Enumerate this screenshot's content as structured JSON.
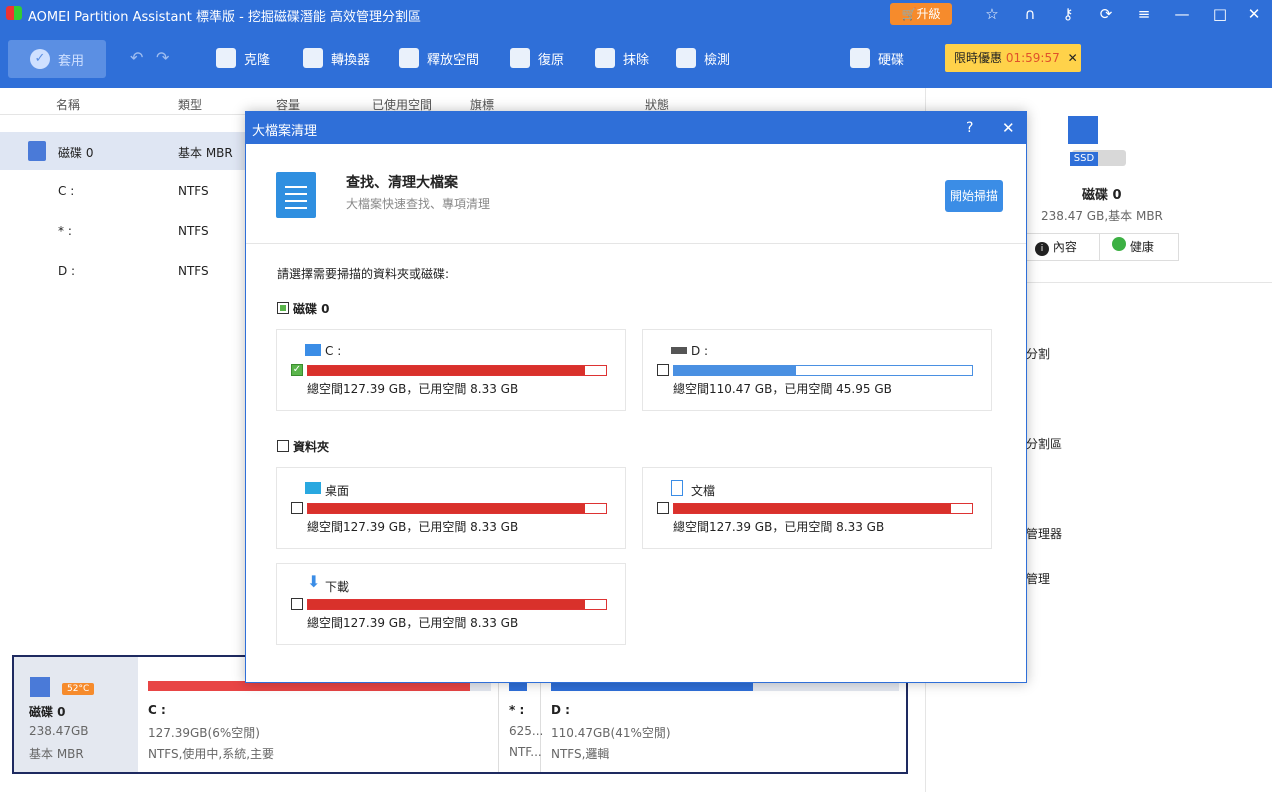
{
  "app": {
    "title": "AOMEI Partition Assistant 標準版 - 挖掘磁碟潛能 高效管理分割區",
    "upgrade": "升級"
  },
  "toolbar": {
    "apply": "套用",
    "clone": "克隆",
    "convert": "轉換器",
    "free_space": "釋放空間",
    "restore": "復原",
    "wipe": "抹除",
    "check": "檢測",
    "disk": "硬碟",
    "promo_label": "限時優惠",
    "promo_timer": "01:59:57"
  },
  "list": {
    "headers": [
      "名稱",
      "類型",
      "容量",
      "已使用空間",
      "旗標",
      "狀態"
    ],
    "rows": [
      {
        "name": "磁碟 0",
        "type": "基本 MBR"
      },
      {
        "name": "C :",
        "type": "NTFS"
      },
      {
        "name": "* :",
        "type": "NTFS"
      },
      {
        "name": "D :",
        "type": "NTFS"
      }
    ]
  },
  "dialog": {
    "title": "大檔案清理",
    "help": "?",
    "heading": "查找、清理大檔案",
    "subheading": "大檔案快速查找、專項清理",
    "scan_button": "開始掃描",
    "prompt": "請選擇需要掃描的資料夾或磁碟:",
    "disk_group": "磁碟 0",
    "folder_group": "資料夾",
    "drives": [
      {
        "name": "C :",
        "meta": "總空間127.39 GB，已用空間 8.33 GB",
        "checked": true,
        "fill": 0.93,
        "color": "#d9312b"
      },
      {
        "name": "D :",
        "meta": "總空間110.47 GB，已用空間 45.95 GB",
        "checked": false,
        "fill": 0.41,
        "color": "#4a90e2"
      }
    ],
    "folders": [
      {
        "name": "桌面",
        "meta": "總空間127.39 GB，已用空間 8.33 GB",
        "fill": 0.93
      },
      {
        "name": "文檔",
        "meta": "總空間127.39 GB，已用空間 8.33 GB",
        "fill": 0.93
      },
      {
        "name": "下載",
        "meta": "總空間127.39 GB，已用空間 8.33 GB",
        "fill": 0.93
      }
    ]
  },
  "right": {
    "disk_name": "磁碟 0",
    "disk_info": "238.47 GB,基本 MBR",
    "props": "內容",
    "health": "健康",
    "ssd": "SSD",
    "partial": [
      "分割",
      "",
      "分割區",
      "",
      "管理器",
      "管理"
    ]
  },
  "bottom": {
    "disk_name": "磁碟 0",
    "size": "238.47GB",
    "type": "基本 MBR",
    "temp": "52°C",
    "c_name": "C :",
    "c_size": "127.39GB(6%空閒)",
    "c_info": "NTFS,使用中,系統,主要",
    "s_name": "* :",
    "s_size": "625...",
    "s_info": "NTF...",
    "d_name": "D :",
    "d_size": "110.47GB(41%空閒)",
    "d_info": "NTFS,邏輯"
  }
}
